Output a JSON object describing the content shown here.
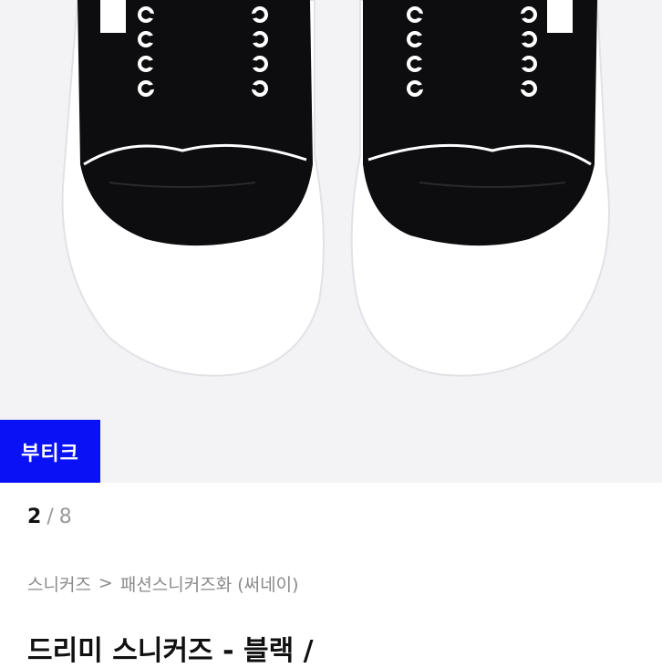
{
  "product_image": {
    "alt_icon": "sneakers-photo",
    "badge_label": "부티크",
    "badge_color": "#0a12f5"
  },
  "pager": {
    "current": "2",
    "separator": "/",
    "total": "8"
  },
  "breadcrumb": {
    "items": [
      "스니커즈",
      "패션스니커즈화 (써네이)"
    ],
    "separator": ">"
  },
  "product": {
    "title": "드리미 스니커즈 - 블랙 /"
  }
}
